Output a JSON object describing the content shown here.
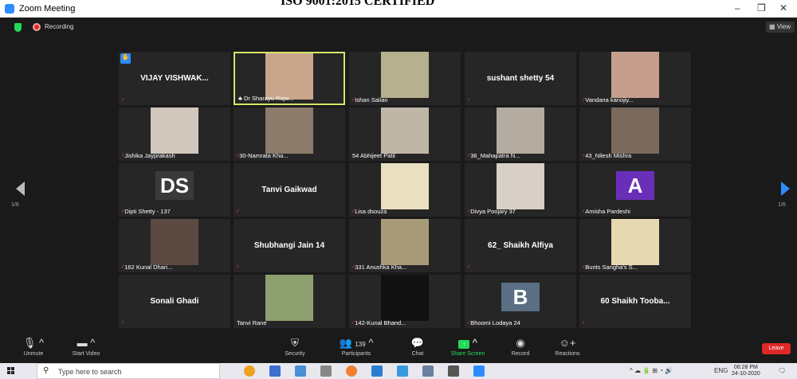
{
  "window": {
    "title": "Zoom Meeting",
    "watermark": "ISO 9001:2015 CERTIFIED",
    "min": "–",
    "restore": "❐",
    "close": "✕"
  },
  "topbar": {
    "recording_label": "Recording",
    "view_label": "View"
  },
  "pages": {
    "left": "1/6",
    "right": "1/6"
  },
  "participants": [
    {
      "name": "",
      "big_name": "VIJAY VISHWAK...",
      "muted": true,
      "raised_hand": true
    },
    {
      "name": "Dr Sharayu Rajw...",
      "muted": false,
      "host_icon": true,
      "video": "#c9a58b"
    },
    {
      "name": "Ishan Salian",
      "muted": true,
      "video": "#b5b08d"
    },
    {
      "name": "",
      "big_name": "sushant shetty 54",
      "muted": true
    },
    {
      "name": "Vandana kanojiy...",
      "muted": true,
      "video": "#c69f8c"
    },
    {
      "name": "Jishika Jayprakash",
      "muted": true,
      "video": "#d1c7bd"
    },
    {
      "name": "30-Namrata Kha...",
      "muted": true,
      "video": "#8c7a6a"
    },
    {
      "name": "54 Abhijeet Patil",
      "muted": false,
      "video": "#c0b6a8"
    },
    {
      "name": "36_Mahapatra N...",
      "muted": true,
      "video": "#b4aca0"
    },
    {
      "name": "43_Nilesh Mishra",
      "muted": true,
      "video": "#7a6a5e"
    },
    {
      "name": "Dipti Shetty - 137",
      "muted": true,
      "avatar": "DS",
      "avatar_bg": "#3a3a3a"
    },
    {
      "name": "",
      "big_name": "Tanvi Gaikwad",
      "muted": true
    },
    {
      "name": "Lisa dsouza",
      "muted": true,
      "video": "#e8e0c0"
    },
    {
      "name": "Divya Poojary 37",
      "muted": true,
      "video": "#d8cfc6"
    },
    {
      "name": "Amisha Pardeshi",
      "muted": true,
      "avatar": "A",
      "avatar_bg": "#6a2fb8"
    },
    {
      "name": "162 Kunal Dhari...",
      "muted": true,
      "video": "#5a4a42"
    },
    {
      "name": "",
      "big_name": "Shubhangi Jain 14",
      "muted": true
    },
    {
      "name": "331 Anushka Kha...",
      "muted": true,
      "video": "#a89c78"
    },
    {
      "name": "",
      "big_name": "62_ Shaikh Alfiya",
      "muted": true
    },
    {
      "name": "Bunts Sangha's S...",
      "muted": true,
      "video": "#e6d8b0"
    },
    {
      "name": "",
      "big_name": "Sonali Ghadi",
      "muted": true
    },
    {
      "name": "Tanvi Rane",
      "muted": false,
      "video": "#8ea070"
    },
    {
      "name": "142-Kunal Bhand...",
      "muted": true,
      "video": "#111111"
    },
    {
      "name": "Bhoomi Lodaya 24",
      "muted": true,
      "avatar": "B",
      "avatar_bg": "#5a6e84"
    },
    {
      "name": "",
      "big_name": "60 Shaikh Tooba...",
      "muted": true
    }
  ],
  "toolbar": {
    "unmute": "Unmute",
    "start_video": "Start Video",
    "security": "Security",
    "participants": "Participants",
    "participants_count": "139",
    "chat": "Chat",
    "share_screen": "Share Screen",
    "record": "Record",
    "reactions": "Reactions",
    "leave": "Leave"
  },
  "taskbar": {
    "search_placeholder": "Type here to search",
    "language": "ENG",
    "time": "06:28 PM",
    "date": "24-10-2020"
  }
}
